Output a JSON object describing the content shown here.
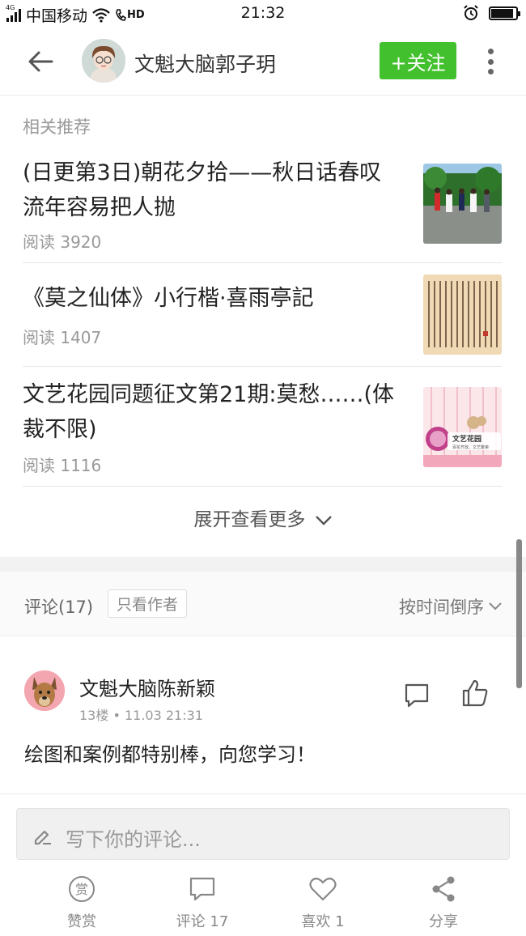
{
  "status_bar": {
    "network": "4G",
    "carrier": "中国移动",
    "hd": "HD",
    "time": "21:32",
    "battery_level": 0.85
  },
  "header": {
    "author_name": "文魁大脑郭子玥",
    "follow_label": "+关注"
  },
  "related": {
    "section_title": "相关推荐",
    "items": [
      {
        "title": "(日更第3日)朝花夕拾——秋日话春叹流年容易把人抛",
        "reads": "阅读 3920",
        "thumb": "photo-of-people-walking"
      },
      {
        "title": "《莫之仙体》小行楷·喜雨亭記",
        "reads": "阅读 1407",
        "thumb": "calligraphy-paper"
      },
      {
        "title": "文艺花园同题征文第21期:莫愁……(体裁不限)",
        "reads": "阅读 1116",
        "thumb": "literary-garden-banner",
        "thumb_title": "文艺花园",
        "thumb_subtitle": "百花齐放、文艺繁荣"
      }
    ],
    "expand_label": "展开查看更多"
  },
  "comments": {
    "count_label": "评论(17)",
    "only_author_label": "只看作者",
    "sort_label": "按时间倒序",
    "items": [
      {
        "author": "文魁大脑陈新颖",
        "meta": "13楼 • 11.03 21:31",
        "text": "绘图和案例都特别棒，向您学习！"
      }
    ]
  },
  "comment_input": {
    "placeholder": "写下你的评论..."
  },
  "bottom_bar": {
    "tip_label": "赞赏",
    "tip_icon_char": "赏",
    "comment_label": "评论 17",
    "like_label": "喜欢 1",
    "share_label": "分享"
  },
  "colors": {
    "accent": "#42c02e",
    "text": "#222222",
    "muted": "#999999"
  }
}
